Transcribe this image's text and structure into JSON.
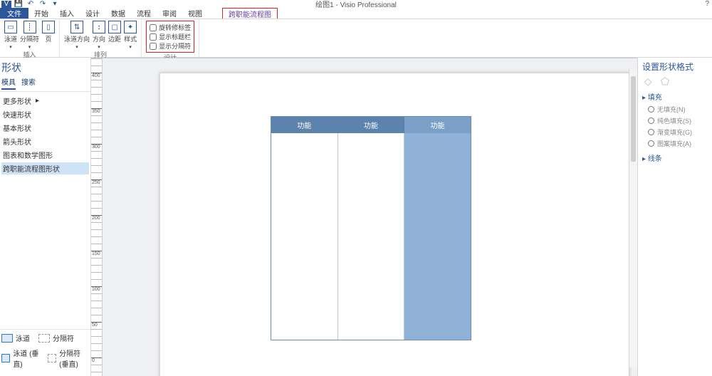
{
  "titlebar": {
    "doc_title": "绘图1 - Visio Professional",
    "help": "?"
  },
  "tabs": {
    "file": "文件",
    "home": "开始",
    "insert": "插入",
    "design": "设计",
    "data": "数据",
    "process": "流程",
    "review": "审阅",
    "view": "视图",
    "contextual": "跨职能流程图"
  },
  "ribbon": {
    "insert_group": "插入",
    "swimlane": "泳道",
    "separator": "分隔符",
    "page": "页",
    "arrange_group": "排列",
    "swimlane_dir": "泳道方向",
    "direction": "方向",
    "margins": "边距",
    "style": "样式",
    "rotate_labels": "旋转修标签",
    "show_titlebar": "显示标题栏",
    "show_separators": "显示分隔符",
    "design_group": "设计"
  },
  "shapes_pane": {
    "title": "形状",
    "tab_stencil": "搜索",
    "tab_search": "搜索",
    "more_shapes": "更多形状",
    "categories": [
      "快速形状",
      "基本形状",
      "箭头形状",
      "图表和数学图形"
    ],
    "selected_category": "跨职能流程图形状",
    "stencil_swimlane": "泳道",
    "stencil_separator": "分隔符",
    "stencil_swimlane_v": "泳道 (垂直)",
    "stencil_separator_v": "分隔符(垂直)"
  },
  "swimlane": {
    "header1": "功能",
    "header2": "功能",
    "header3": "功能"
  },
  "format_pane": {
    "title": "设置形状格式",
    "section_fill": "填充",
    "no_fill": "无填充(N)",
    "solid_fill": "纯色填充(S)",
    "gradient_fill": "渐变填充(G)",
    "pattern_fill": "图案填充(A)",
    "section_line": "线条"
  }
}
